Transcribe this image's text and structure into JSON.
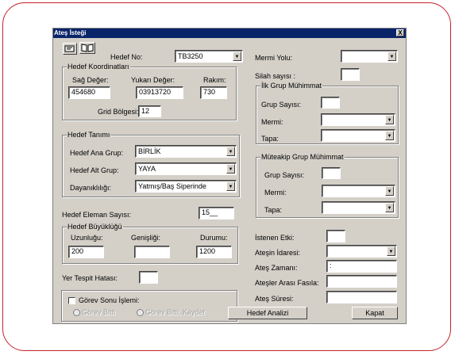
{
  "window": {
    "title": "Ateş İsteği",
    "close_label": "X"
  },
  "toolbar": {
    "icon1": "card-icon",
    "icon2": "book-icon"
  },
  "target": {
    "label": "Hedef No:",
    "value": "TB3250"
  },
  "coords": {
    "group_title": "Hedef Koordinatları",
    "right_label": "Sağ Değer:",
    "right_value": "454680",
    "up_label": "Yukarı Değer:",
    "up_value": "03913720",
    "alt_label": "Rakım:",
    "alt_value": "730",
    "grid_label": "Grid Bölgesi:",
    "grid_value": "12"
  },
  "definition": {
    "group_title": "Hedef Tanımı",
    "main_label": "Hedef Ana Grup:",
    "main_value": "BİRLİK",
    "sub_label": "Hedef Alt Grup:",
    "sub_value": "YAYA",
    "dur_label": "Dayanıklılığı:",
    "dur_value": "Yatmış/Baş Siperinde"
  },
  "count": {
    "label": "Hedef Eleman Sayısı:",
    "value": "15__"
  },
  "size": {
    "group_title": "Hedef Büyüklüğü",
    "len_label": "Uzunluğu:",
    "len_value": "200",
    "wid_label": "Genişliği:",
    "wid_value": "",
    "att_label": "Durumu:",
    "att_value": "1200"
  },
  "error": {
    "label": "Yer Tespit Hatası:",
    "value": ""
  },
  "post": {
    "check_label": "Görev Sonu İşlemi:",
    "radio1": "Görev Bitti",
    "radio2": "Görev Bitti, Kaydet"
  },
  "right": {
    "ammo_path_label": "Mermi Yolu:",
    "ammo_path_value": "",
    "weapon_count_label": "Silah sayısı :",
    "weapon_count_value": "",
    "first": {
      "group_title": "İlk Grup Mühimmat",
      "count_label": "Grup Sayısı:",
      "count_value": "",
      "ammo_label": "Mermi:",
      "ammo_value": "",
      "fuse_label": "Tapa:",
      "fuse_value": ""
    },
    "next": {
      "group_title": "Müteakip Grup Mühimmat",
      "count_label": "Grup Sayısı:",
      "count_value": "",
      "ammo_label": "Mermi:",
      "ammo_value": "",
      "fuse_label": "Tapa:",
      "fuse_value": ""
    },
    "effect_label": "İstenen Etki:",
    "effect_value": "",
    "control_label": "Ateşin İdaresi:",
    "control_value": "",
    "time_label": "Ateş Zamanı:",
    "time_value": ":",
    "interval_label": "Ateşler Arası Fasıla:",
    "interval_value": "",
    "duration_label": "Ateş Süresi:",
    "duration_value": ""
  },
  "buttons": {
    "analysis": "Hedef Analizi",
    "close": "Kapat"
  },
  "colors": {
    "frame": "#c4222a",
    "titlebar": "#0a246a",
    "dialog": "#d4d0c8"
  }
}
